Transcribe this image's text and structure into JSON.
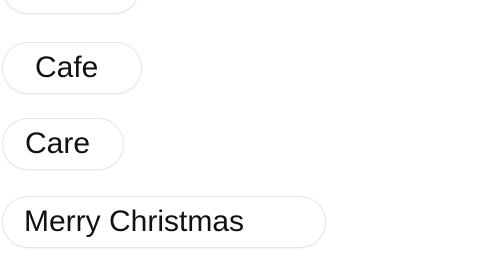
{
  "suggestions": {
    "items": [
      {
        "label": ""
      },
      {
        "label": "Cafe"
      },
      {
        "label": "Care"
      },
      {
        "label": "Merry Christmas"
      }
    ]
  }
}
